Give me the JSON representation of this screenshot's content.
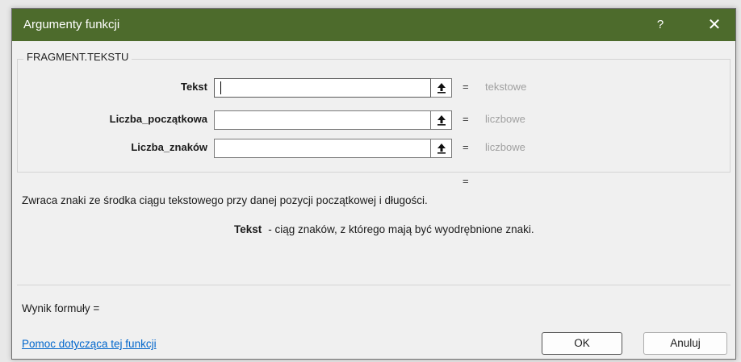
{
  "window": {
    "title": "Argumenty funkcji",
    "help_label": "?",
    "close_label": "✕"
  },
  "function_group": {
    "name": "FRAGMENT.TEKSTU",
    "arguments": [
      {
        "label": "Tekst",
        "value": "",
        "equals": "=",
        "result": "tekstowe"
      },
      {
        "label": "Liczba_początkowa",
        "value": "",
        "equals": "=",
        "result": "liczbowe"
      },
      {
        "label": "Liczba_znaków",
        "value": "",
        "equals": "=",
        "result": "liczbowe"
      }
    ]
  },
  "total_equals": "=",
  "description": "Zwraca znaki ze środka ciągu tekstowego przy danej pozycji początkowej i długości.",
  "argument_help": {
    "name": "Tekst",
    "text": "- ciąg znaków, z którego mają być wyodrębnione znaki."
  },
  "formula_result_label": "Wynik formuły =",
  "help_link": "Pomoc dotycząca tej funkcji",
  "buttons": {
    "ok": "OK",
    "cancel": "Anuluj"
  },
  "colors": {
    "titlebar": "#4d6b2c",
    "link": "#0066cc",
    "result_text": "#a0a0a0"
  }
}
